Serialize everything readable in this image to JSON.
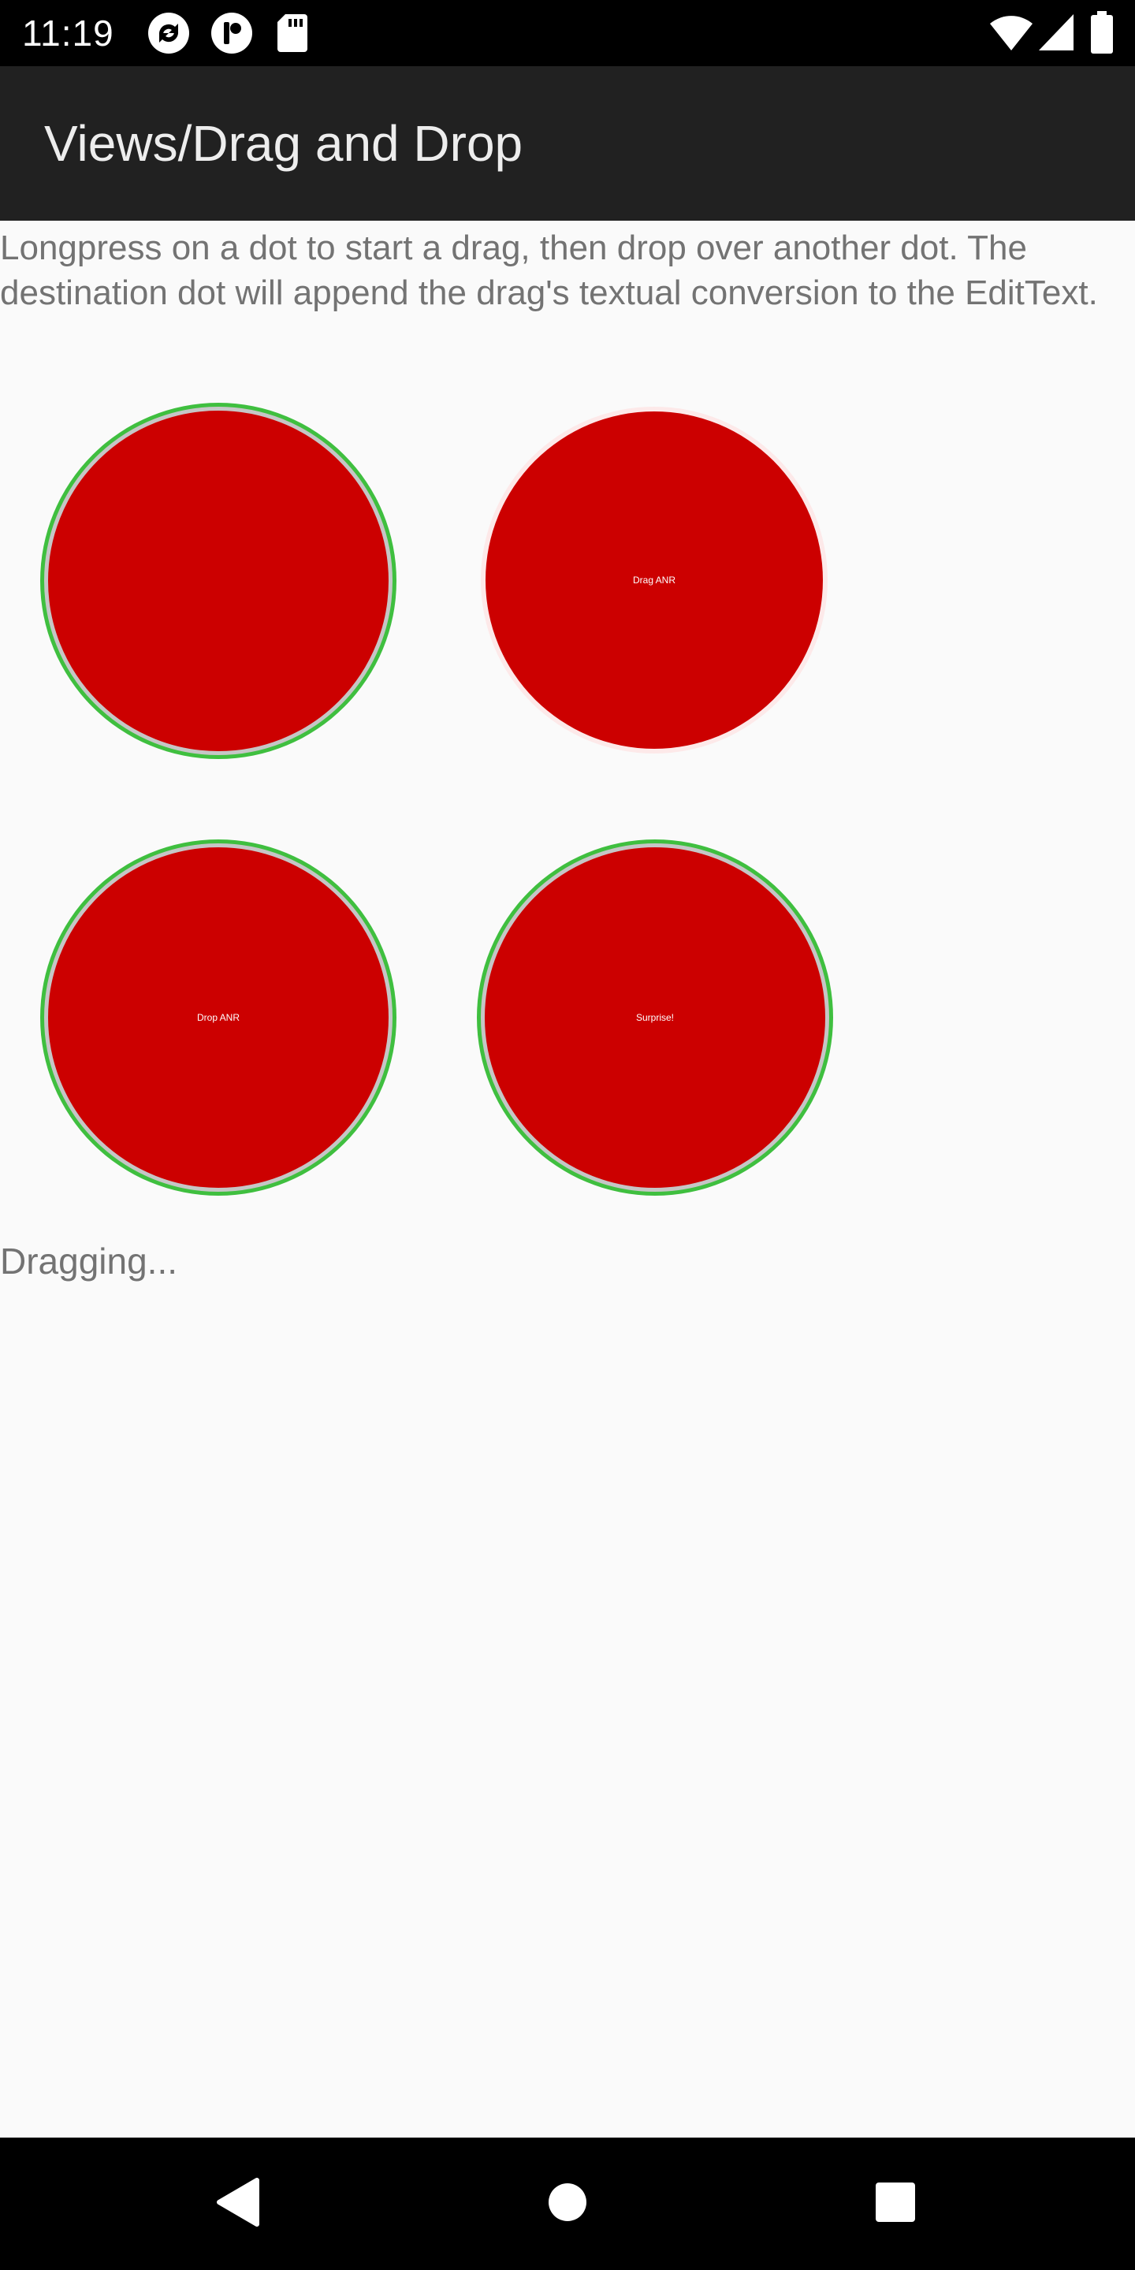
{
  "status_bar": {
    "time": "11:19",
    "icons": [
      "sync-icon",
      "app-notification-icon",
      "sd-card-icon",
      "wifi-icon",
      "signal-icon",
      "battery-icon"
    ]
  },
  "action_bar": {
    "title": "Views/Drag and Drop"
  },
  "content": {
    "instructions": "Longpress on a dot to start a drag, then drop over another dot. The destination dot will append the drag's textual conversion to the EditText.",
    "dots": [
      {
        "label": "",
        "state": "highlight"
      },
      {
        "label": "Drag ANR",
        "state": "plain"
      },
      {
        "label": "Drop ANR",
        "state": "highlight"
      },
      {
        "label": "Surprise!",
        "state": "highlight"
      }
    ],
    "result_text": "Dragging..."
  },
  "colors": {
    "dot_fill": "#cc0000",
    "dot_highlight_ring": "#3fbf3f",
    "action_bar": "#212121",
    "background": "#fafafa"
  },
  "nav_bar": {
    "icons": [
      "back-icon",
      "home-icon",
      "recents-icon"
    ]
  }
}
